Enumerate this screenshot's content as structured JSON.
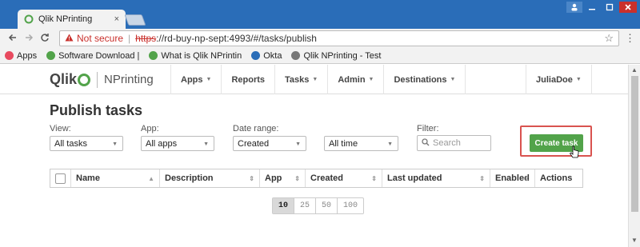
{
  "browser": {
    "tab_title": "Qlik NPrinting",
    "tab_close": "×",
    "omnibox": {
      "not_secure": "Not secure",
      "url_https": "https",
      "url_rest": "://rd-buy-np-sept:4993/#/tasks/publish"
    },
    "bookmarks": [
      {
        "label": "Apps",
        "icon": "apps-grid-icon",
        "color": "#e84a5f"
      },
      {
        "label": "Software Download |",
        "icon": "qlik-icon",
        "color": "#52a34a"
      },
      {
        "label": "What is Qlik NPrintin",
        "icon": "qlik-icon",
        "color": "#52a34a"
      },
      {
        "label": "Okta",
        "icon": "okta-icon",
        "color": "#2a6db8"
      },
      {
        "label": "Qlik NPrinting - Test",
        "icon": "page-icon",
        "color": "#777777"
      }
    ]
  },
  "app": {
    "logo_text": "Qlik",
    "product": "NPrinting",
    "nav": [
      {
        "label": "Apps",
        "dropdown": true
      },
      {
        "label": "Reports",
        "dropdown": false
      },
      {
        "label": "Tasks",
        "dropdown": true
      },
      {
        "label": "Admin",
        "dropdown": true
      },
      {
        "label": "Destinations",
        "dropdown": true
      }
    ],
    "user": "JuliaDoe"
  },
  "page": {
    "title": "Publish tasks",
    "filters": {
      "view": {
        "label": "View:",
        "value": "All tasks"
      },
      "app": {
        "label": "App:",
        "value": "All apps"
      },
      "date_range": {
        "label": "Date range:",
        "value": "Created",
        "period": "All time"
      },
      "filter": {
        "label": "Filter:",
        "placeholder": "Search"
      }
    },
    "create_button": "Create task",
    "table": {
      "columns": [
        "Name",
        "Description",
        "App",
        "Created",
        "Last updated",
        "Enabled",
        "Actions"
      ]
    },
    "pagination": [
      "10",
      "25",
      "50",
      "100"
    ],
    "page_size_selected": "10"
  },
  "colors": {
    "accent_green": "#52a34a",
    "highlight_red": "#d9534f",
    "titlebar_blue": "#2a6db8"
  }
}
